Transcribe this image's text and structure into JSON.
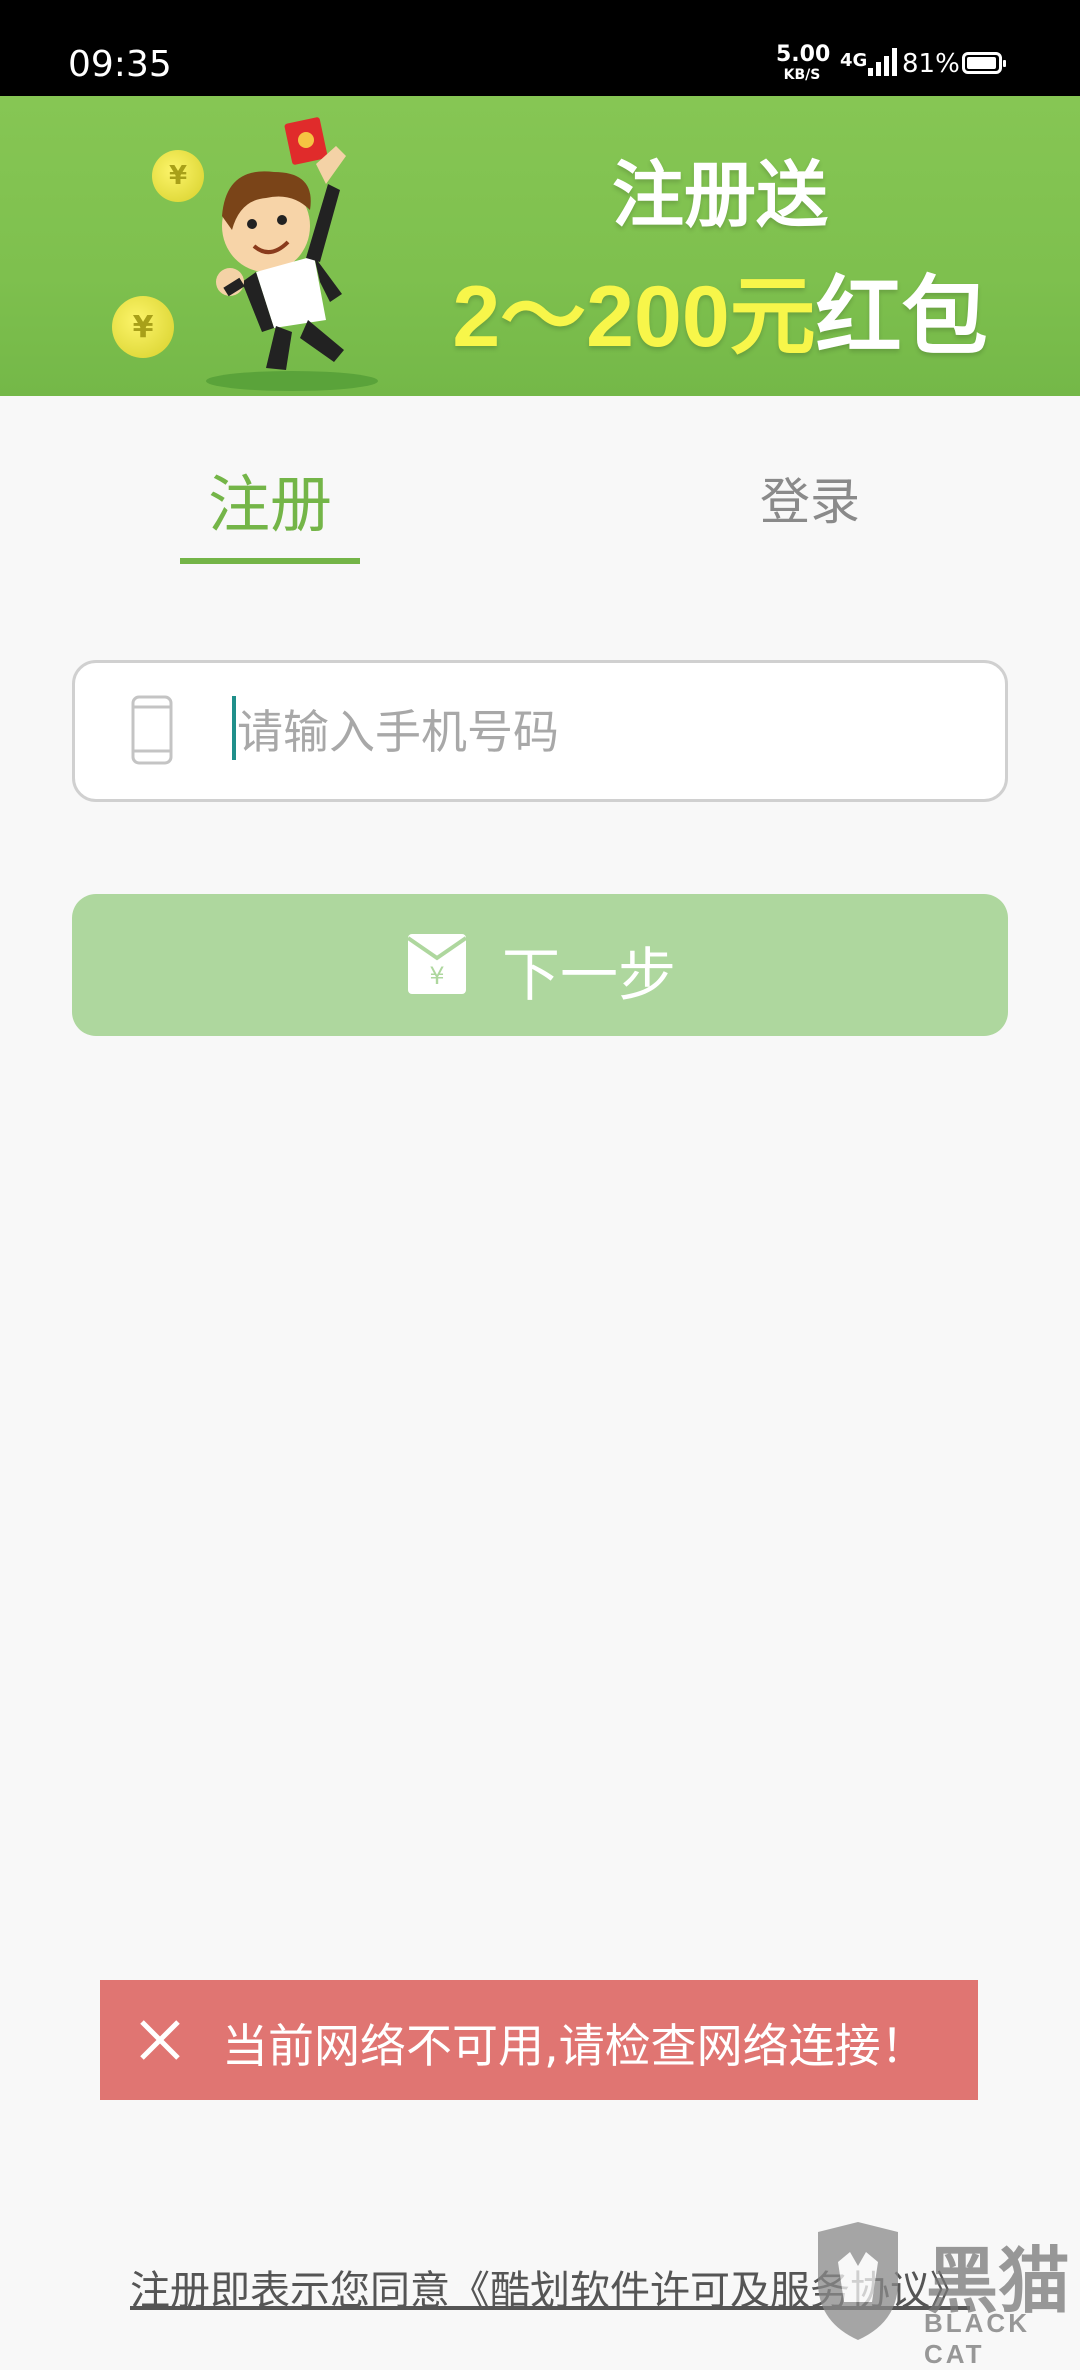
{
  "status_bar": {
    "time": "09:35",
    "net_speed_value": "5.00",
    "net_speed_unit": "KB/S",
    "network_type": "4G",
    "battery_percent": "81%",
    "battery_level": 0.81
  },
  "banner": {
    "title": "注册送",
    "promo_amount": "2～200元",
    "promo_suffix": "红包"
  },
  "tabs": {
    "register": "注册",
    "login": "登录",
    "active": "register"
  },
  "form": {
    "phone_placeholder": "请输入手机号码",
    "phone_value": "",
    "next_label": "下一步"
  },
  "toast": {
    "message": "当前网络不可用,请检查网络连接！"
  },
  "footer": {
    "agreement_text": "注册即表示您同意《酷划软件许可及服务协议》"
  },
  "watermark": {
    "text": "黑猫",
    "subtext": "BLACK CAT"
  },
  "colors": {
    "accent_green": "#74b548",
    "button_disabled": "#aed79e",
    "toast_red": "#e07572",
    "promo_yellow": "#f7f64a"
  }
}
